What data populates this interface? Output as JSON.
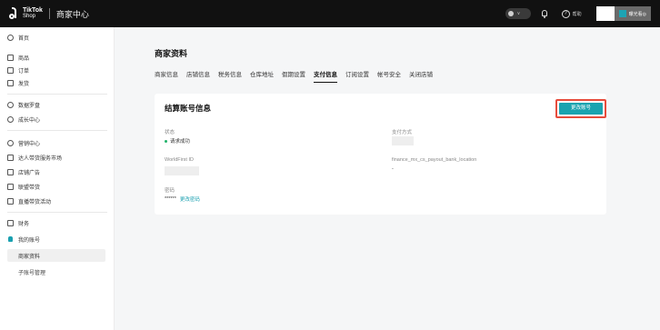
{
  "header": {
    "brand_main": "TikTok",
    "brand_sub": "Shop",
    "center_title": "商家中心",
    "status_caret": "∨",
    "help_label": "帮助",
    "account_name": "曝光看◎"
  },
  "sidebar": {
    "items": [
      {
        "label": "首页",
        "icon": "home-icon"
      },
      {
        "label": "商品",
        "icon": "product-icon"
      },
      {
        "label": "订单",
        "icon": "order-icon"
      },
      {
        "label": "发货",
        "icon": "shipping-icon"
      },
      {
        "label": "数据罗盘",
        "icon": "compass-icon"
      },
      {
        "label": "成长中心",
        "icon": "growth-icon"
      },
      {
        "label": "营销中心",
        "icon": "marketing-icon"
      },
      {
        "label": "达人带货服务市场",
        "icon": "creator-icon"
      },
      {
        "label": "店铺广告",
        "icon": "ads-icon"
      },
      {
        "label": "联盟带货",
        "icon": "affiliate-icon"
      },
      {
        "label": "直播带货活动",
        "icon": "live-icon"
      },
      {
        "label": "财务",
        "icon": "finance-icon"
      },
      {
        "label": "我的账号",
        "icon": "account-icon"
      }
    ],
    "sub_items": [
      {
        "label": "商家资料"
      },
      {
        "label": "子账号管理"
      }
    ]
  },
  "main": {
    "page_title": "商家资料",
    "tabs": [
      {
        "label": "商家信息"
      },
      {
        "label": "店铺信息"
      },
      {
        "label": "税务信息"
      },
      {
        "label": "仓库地址"
      },
      {
        "label": "假期设置"
      },
      {
        "label": "支付信息"
      },
      {
        "label": "订阅设置"
      },
      {
        "label": "帐号安全"
      },
      {
        "label": "关闭店铺"
      }
    ],
    "card": {
      "title": "结算账号信息",
      "change_button": "更改账号",
      "status_label": "状态",
      "status_value": "请求成功",
      "payment_method_label": "支付方式",
      "worldfirst_label": "WorldFirst ID",
      "finance_label": "finance_mx_cs_payout_bank_location",
      "finance_value": "-",
      "password_label": "密码",
      "password_value": "******",
      "password_link": "更改密码"
    }
  },
  "colors": {
    "accent": "#1aa3b0",
    "topbar": "#111111",
    "success": "#21b36b",
    "highlight_border": "#e74c3c"
  }
}
